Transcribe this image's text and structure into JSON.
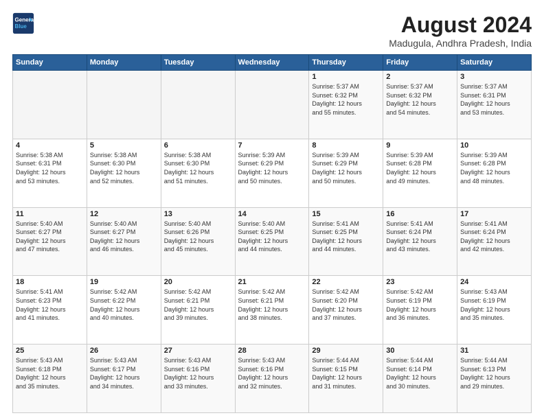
{
  "header": {
    "logo_line1": "General",
    "logo_line2": "Blue",
    "month_title": "August 2024",
    "location": "Madugula, Andhra Pradesh, India"
  },
  "weekdays": [
    "Sunday",
    "Monday",
    "Tuesday",
    "Wednesday",
    "Thursday",
    "Friday",
    "Saturday"
  ],
  "weeks": [
    [
      {
        "day": "",
        "info": ""
      },
      {
        "day": "",
        "info": ""
      },
      {
        "day": "",
        "info": ""
      },
      {
        "day": "",
        "info": ""
      },
      {
        "day": "1",
        "info": "Sunrise: 5:37 AM\nSunset: 6:32 PM\nDaylight: 12 hours\nand 55 minutes."
      },
      {
        "day": "2",
        "info": "Sunrise: 5:37 AM\nSunset: 6:32 PM\nDaylight: 12 hours\nand 54 minutes."
      },
      {
        "day": "3",
        "info": "Sunrise: 5:37 AM\nSunset: 6:31 PM\nDaylight: 12 hours\nand 53 minutes."
      }
    ],
    [
      {
        "day": "4",
        "info": "Sunrise: 5:38 AM\nSunset: 6:31 PM\nDaylight: 12 hours\nand 53 minutes."
      },
      {
        "day": "5",
        "info": "Sunrise: 5:38 AM\nSunset: 6:30 PM\nDaylight: 12 hours\nand 52 minutes."
      },
      {
        "day": "6",
        "info": "Sunrise: 5:38 AM\nSunset: 6:30 PM\nDaylight: 12 hours\nand 51 minutes."
      },
      {
        "day": "7",
        "info": "Sunrise: 5:39 AM\nSunset: 6:29 PM\nDaylight: 12 hours\nand 50 minutes."
      },
      {
        "day": "8",
        "info": "Sunrise: 5:39 AM\nSunset: 6:29 PM\nDaylight: 12 hours\nand 50 minutes."
      },
      {
        "day": "9",
        "info": "Sunrise: 5:39 AM\nSunset: 6:28 PM\nDaylight: 12 hours\nand 49 minutes."
      },
      {
        "day": "10",
        "info": "Sunrise: 5:39 AM\nSunset: 6:28 PM\nDaylight: 12 hours\nand 48 minutes."
      }
    ],
    [
      {
        "day": "11",
        "info": "Sunrise: 5:40 AM\nSunset: 6:27 PM\nDaylight: 12 hours\nand 47 minutes."
      },
      {
        "day": "12",
        "info": "Sunrise: 5:40 AM\nSunset: 6:27 PM\nDaylight: 12 hours\nand 46 minutes."
      },
      {
        "day": "13",
        "info": "Sunrise: 5:40 AM\nSunset: 6:26 PM\nDaylight: 12 hours\nand 45 minutes."
      },
      {
        "day": "14",
        "info": "Sunrise: 5:40 AM\nSunset: 6:25 PM\nDaylight: 12 hours\nand 44 minutes."
      },
      {
        "day": "15",
        "info": "Sunrise: 5:41 AM\nSunset: 6:25 PM\nDaylight: 12 hours\nand 44 minutes."
      },
      {
        "day": "16",
        "info": "Sunrise: 5:41 AM\nSunset: 6:24 PM\nDaylight: 12 hours\nand 43 minutes."
      },
      {
        "day": "17",
        "info": "Sunrise: 5:41 AM\nSunset: 6:24 PM\nDaylight: 12 hours\nand 42 minutes."
      }
    ],
    [
      {
        "day": "18",
        "info": "Sunrise: 5:41 AM\nSunset: 6:23 PM\nDaylight: 12 hours\nand 41 minutes."
      },
      {
        "day": "19",
        "info": "Sunrise: 5:42 AM\nSunset: 6:22 PM\nDaylight: 12 hours\nand 40 minutes."
      },
      {
        "day": "20",
        "info": "Sunrise: 5:42 AM\nSunset: 6:21 PM\nDaylight: 12 hours\nand 39 minutes."
      },
      {
        "day": "21",
        "info": "Sunrise: 5:42 AM\nSunset: 6:21 PM\nDaylight: 12 hours\nand 38 minutes."
      },
      {
        "day": "22",
        "info": "Sunrise: 5:42 AM\nSunset: 6:20 PM\nDaylight: 12 hours\nand 37 minutes."
      },
      {
        "day": "23",
        "info": "Sunrise: 5:42 AM\nSunset: 6:19 PM\nDaylight: 12 hours\nand 36 minutes."
      },
      {
        "day": "24",
        "info": "Sunrise: 5:43 AM\nSunset: 6:19 PM\nDaylight: 12 hours\nand 35 minutes."
      }
    ],
    [
      {
        "day": "25",
        "info": "Sunrise: 5:43 AM\nSunset: 6:18 PM\nDaylight: 12 hours\nand 35 minutes."
      },
      {
        "day": "26",
        "info": "Sunrise: 5:43 AM\nSunset: 6:17 PM\nDaylight: 12 hours\nand 34 minutes."
      },
      {
        "day": "27",
        "info": "Sunrise: 5:43 AM\nSunset: 6:16 PM\nDaylight: 12 hours\nand 33 minutes."
      },
      {
        "day": "28",
        "info": "Sunrise: 5:43 AM\nSunset: 6:16 PM\nDaylight: 12 hours\nand 32 minutes."
      },
      {
        "day": "29",
        "info": "Sunrise: 5:44 AM\nSunset: 6:15 PM\nDaylight: 12 hours\nand 31 minutes."
      },
      {
        "day": "30",
        "info": "Sunrise: 5:44 AM\nSunset: 6:14 PM\nDaylight: 12 hours\nand 30 minutes."
      },
      {
        "day": "31",
        "info": "Sunrise: 5:44 AM\nSunset: 6:13 PM\nDaylight: 12 hours\nand 29 minutes."
      }
    ]
  ]
}
